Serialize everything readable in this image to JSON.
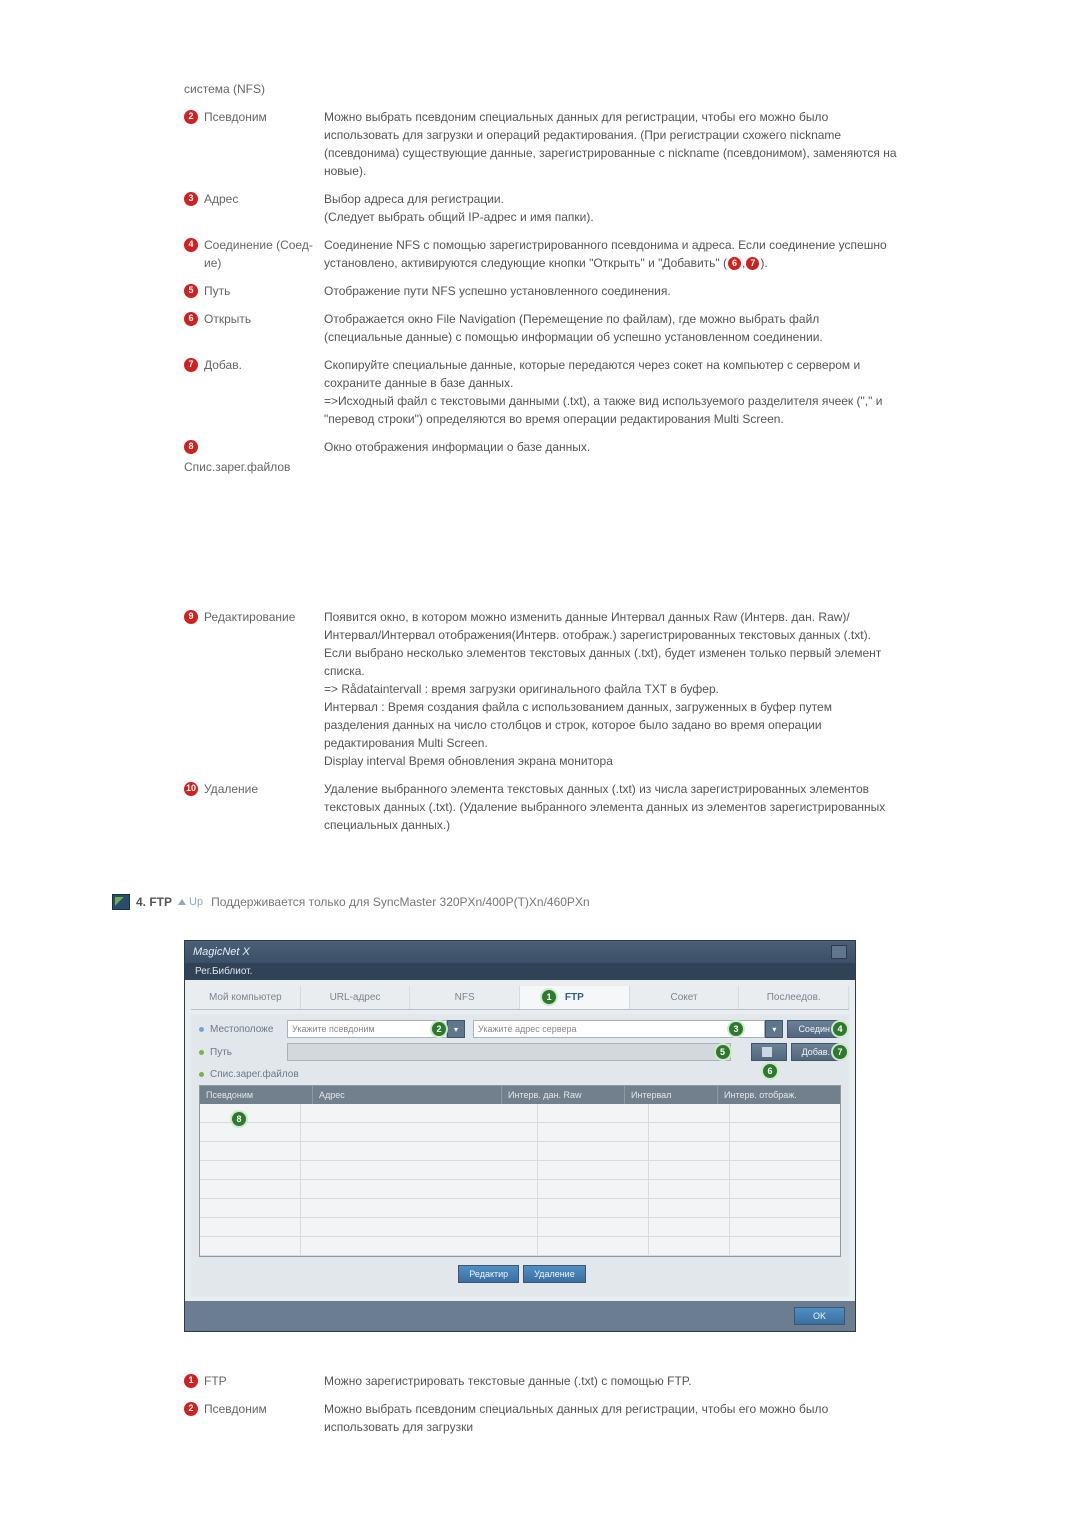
{
  "preline": "система (NFS)",
  "items_top": [
    {
      "n": "2",
      "label": "Псевдоним",
      "desc": "Можно выбрать псевдоним специальных данных для регистрации, чтобы его можно было использовать для загрузки и операций редактирования. (При регистрации схожего nickname (псевдонима) существующие данные, зарегистрированные с nickname (псевдонимом), заменяются на новые)."
    },
    {
      "n": "3",
      "label": "Адрес",
      "desc": "Выбор адреса для регистрации.\n(Следует выбрать общий IP-адрес и имя папки)."
    },
    {
      "n": "4",
      "label": "Соединение (Соед-ие)",
      "desc": "Соединение NFS с помощью зарегистрированного псевдонима и адреса. Если соединение успешно установлено, активируются следующие кнопки \"Открыть\" и \"Добавить\" (",
      "desc_tail": ")."
    },
    {
      "n": "5",
      "label": "Путь",
      "desc": "Отображение пути NFS успешно установленного соединения."
    },
    {
      "n": "6",
      "label": "Открыть",
      "desc": "Отображается окно File Navigation (Перемещение по файлам), где можно выбрать файл (специальные данные) с помощью информации об успешно установленном соединении."
    },
    {
      "n": "7",
      "label": "Добав.",
      "desc": "Скопируйте специальные данные, которые передаются через сокет на компьютер с сервером и сохраните данные в базе данных.\n=>Исходный файл с текстовыми данными (.txt), а также вид используемого разделителя ячеек (\",\" и \"перевод строки\") определяются во время операции редактирования Multi Screen."
    },
    {
      "n": "8",
      "label": "Спис.зарег.файлов",
      "desc": "Окно отображения информации о базе данных.",
      "full": true
    },
    {
      "n": "9",
      "label": "Редактирование",
      "desc": "Появится окно, в котором можно изменить данные Интервал данных Raw (Интерв. дан. Raw)/Интервал/Интервал отображения(Интерв. отображ.) зарегистрированных текстовых данных (.txt).\nЕсли выбрано несколько элементов текстовых данных (.txt), будет изменен только первый элемент списка.\n=> Rådataintervall : время загрузки оригинального файла TXT в буфер.\nИнтервал : Время создания файла с использованием данных, загруженных в буфер путем разделения данных на число столбцов и строк, которое было задано во время операции редактирования Multi Screen.\nDisplay interval Время обновления экрана монитора"
    },
    {
      "n": "10",
      "label": "Удаление",
      "desc": "Удаление выбранного элемента текстовых данных (.txt) из числа зарегистрированных элементов текстовых данных (.txt). (Удаление выбранного элемента данных из элементов зарегистрированных специальных данных.)"
    }
  ],
  "inline_refs": {
    "a": "6",
    "b": "7"
  },
  "section": {
    "title": "4. FTP",
    "up": "Up",
    "note": "Поддерживается только для SyncMaster 320PXn/400P(T)Xn/460PXn"
  },
  "app": {
    "title": "MagicNet X",
    "reg": "Рег.Библиот.",
    "tabs": [
      "Мой компьютер",
      "URL-адрес",
      "NFS",
      "FTP",
      "Сокет",
      "Послеедов."
    ],
    "active_tab": 3,
    "row_loc_label": "Местоположе",
    "row_loc_ph": "Укажите псевдоним",
    "row_addr_ph": "Укажите адрес сервера",
    "btn_conn": "Соедин",
    "row_path_label": "Путь",
    "btn_add": "Добав.",
    "row_list_label": "Спис.зарег.файлов",
    "th": [
      "Псевдоним",
      "Адрес",
      "Интерв. дан. Raw",
      "Интервал",
      "Интерв. отображ."
    ],
    "btn_edit": "Редактир",
    "btn_del": "Удаление",
    "btn_ok": "OK"
  },
  "items_bottom": [
    {
      "n": "1",
      "label": "FTP",
      "desc": "Можно зарегистрировать текстовые данные (.txt) с помощью FTP."
    },
    {
      "n": "2",
      "label": "Псевдоним",
      "desc": "Можно выбрать псевдоним специальных данных для регистрации, чтобы его можно было использовать для загрузки"
    }
  ]
}
